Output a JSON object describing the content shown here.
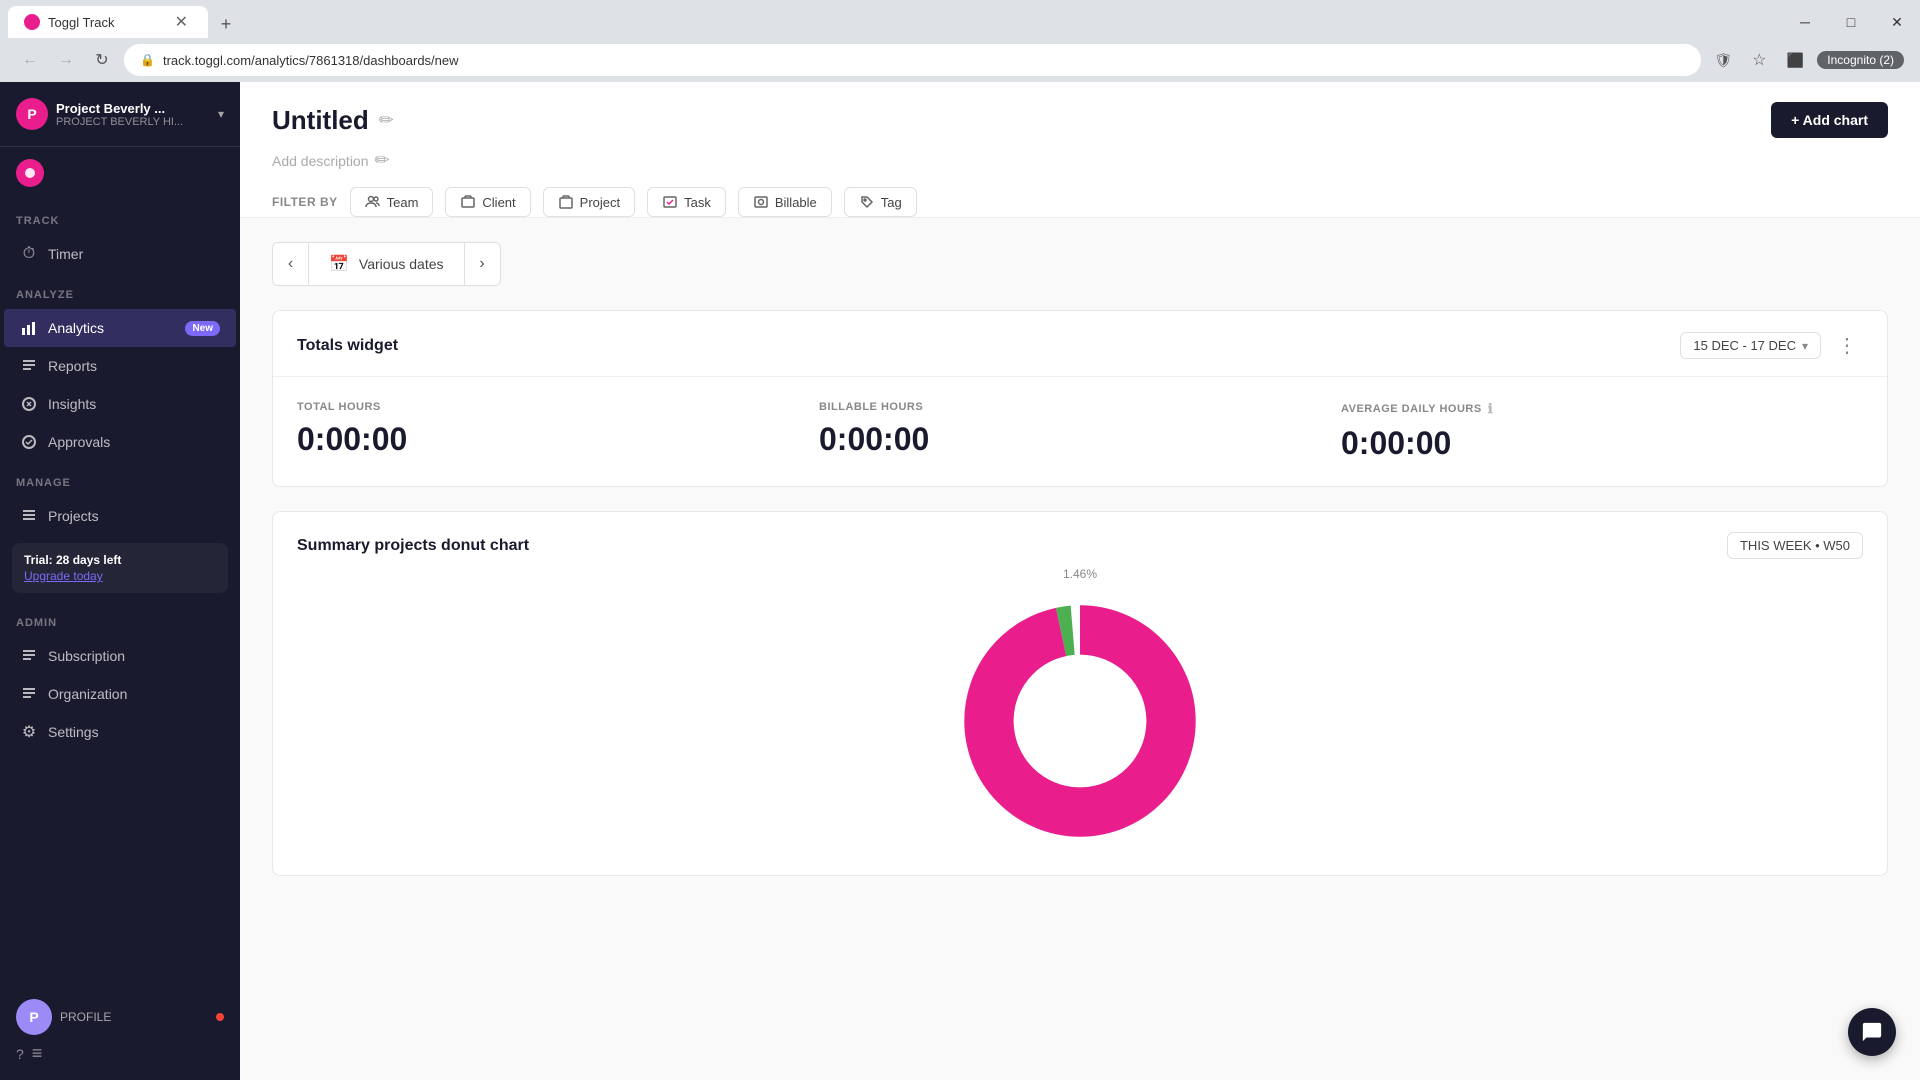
{
  "browser": {
    "tab_label": "Toggl Track",
    "url": "track.toggl.com/analytics/7861318/dashboards/new",
    "incognito_label": "Incognito (2)"
  },
  "sidebar": {
    "workspace_name": "Project Beverly ...",
    "workspace_sub": "PROJECT BEVERLY HI...",
    "sections": {
      "track_label": "TRACK",
      "analyze_label": "ANALYZE",
      "manage_label": "MANAGE",
      "admin_label": "ADMIN"
    },
    "track_items": [
      {
        "id": "timer",
        "label": "Timer",
        "icon": "⏱"
      }
    ],
    "analyze_items": [
      {
        "id": "analytics",
        "label": "Analytics",
        "icon": "📊",
        "badge": "New",
        "active": true
      },
      {
        "id": "reports",
        "label": "Reports",
        "icon": "☰"
      },
      {
        "id": "insights",
        "label": "Insights",
        "icon": "✓"
      },
      {
        "id": "approvals",
        "label": "Approvals",
        "icon": "✓"
      }
    ],
    "manage_items": [
      {
        "id": "projects",
        "label": "Projects",
        "icon": "☰"
      }
    ],
    "admin_items": [
      {
        "id": "subscription",
        "label": "Subscription",
        "icon": "☰"
      },
      {
        "id": "organization",
        "label": "Organization",
        "icon": "☰"
      },
      {
        "id": "settings",
        "label": "Settings",
        "icon": "⚙"
      }
    ],
    "trial_label": "Trial: 28 days left",
    "upgrade_label": "Upgrade today",
    "profile_label": "PROFILE",
    "collapse_icon": "≡"
  },
  "page": {
    "title": "Untitled",
    "description": "Add description",
    "add_chart_label": "+ Add chart",
    "edit_icon": "✏",
    "filter_label": "FILTER BY",
    "filters": [
      {
        "id": "team",
        "label": "Team",
        "icon": "team"
      },
      {
        "id": "client",
        "label": "Client",
        "icon": "client"
      },
      {
        "id": "project",
        "label": "Project",
        "icon": "project"
      },
      {
        "id": "task",
        "label": "Task",
        "icon": "task"
      },
      {
        "id": "billable",
        "label": "Billable",
        "icon": "billable"
      },
      {
        "id": "tag",
        "label": "Tag",
        "icon": "tag"
      }
    ]
  },
  "date_range": {
    "label": "Various dates"
  },
  "totals_widget": {
    "title": "Totals widget",
    "date_range": "15 DEC - 17 DEC",
    "metrics": [
      {
        "id": "total_hours",
        "label": "TOTAL HOURS",
        "value": "0:00:00",
        "has_info": false
      },
      {
        "id": "billable_hours",
        "label": "BILLABLE HOURS",
        "value": "0:00:00",
        "has_info": false
      },
      {
        "id": "avg_daily",
        "label": "AVERAGE DAILY HOURS",
        "value": "0:00:00",
        "has_info": true
      }
    ]
  },
  "donut_widget": {
    "title": "Summary projects donut chart",
    "week_label": "THIS WEEK • W50",
    "percentage_label": "1.46%",
    "colors": {
      "pink": "#e91e8c",
      "green": "#4caf50"
    }
  }
}
